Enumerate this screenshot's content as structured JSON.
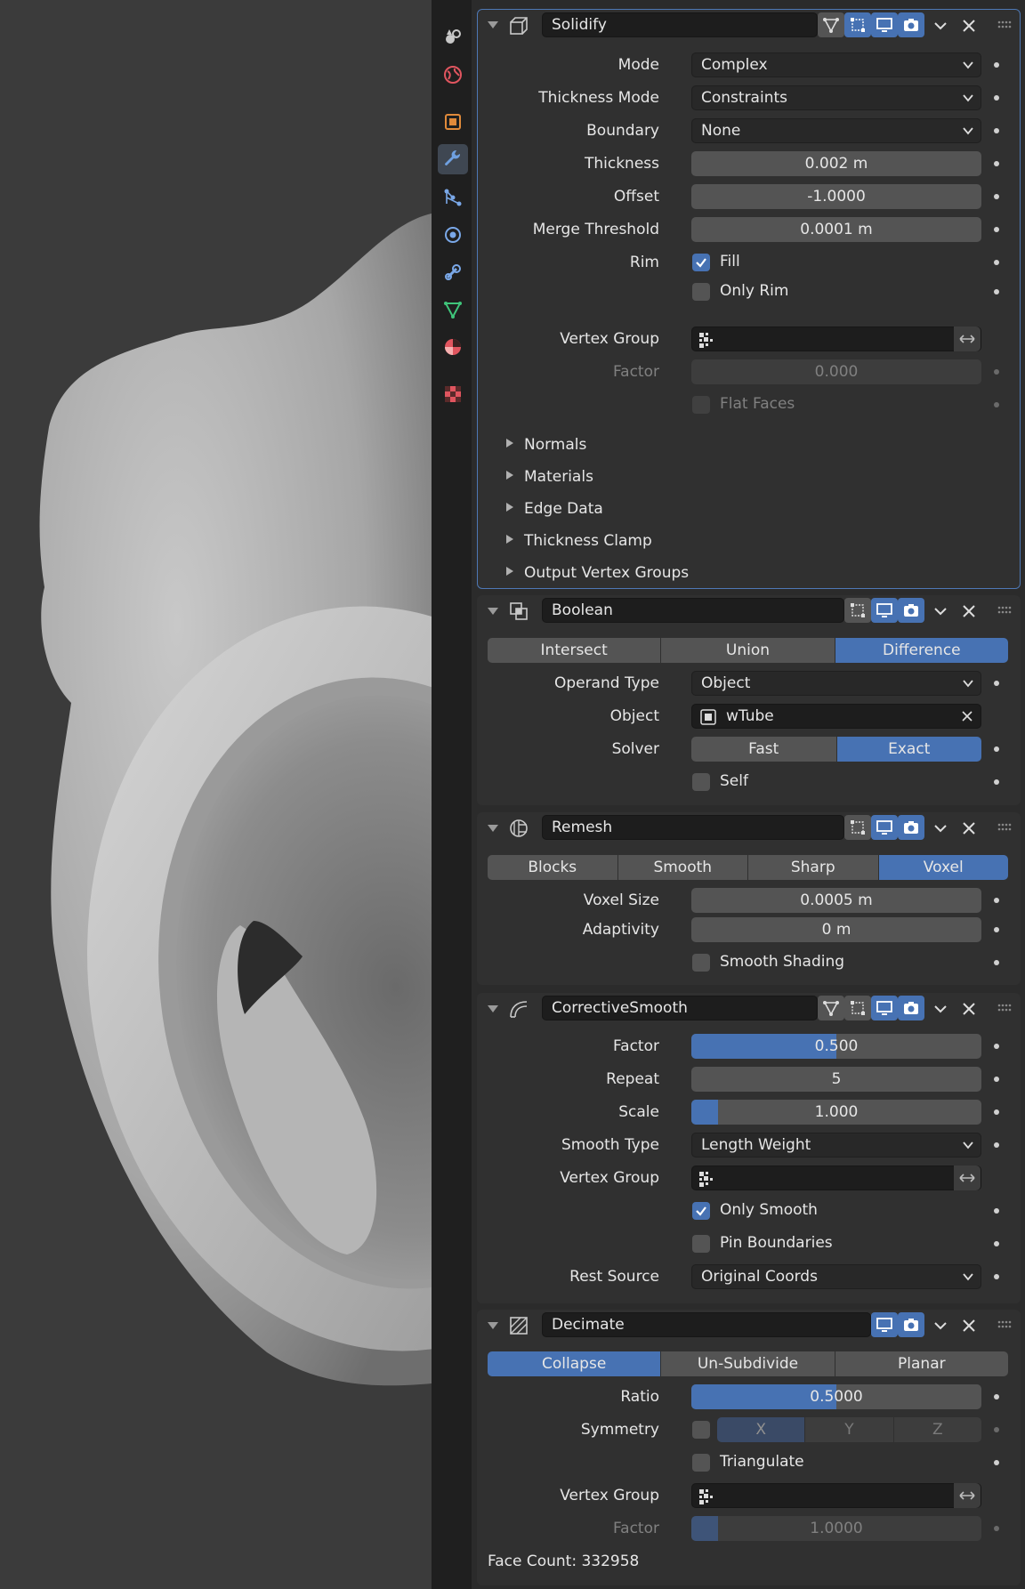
{
  "tabs": [
    "scene-icon",
    "world-icon",
    "object-icon",
    "modifier-wrench-icon",
    "particles-icon",
    "physics-icon",
    "constraints-icon",
    "object-data-mesh-icon",
    "material-icon",
    "texture-icon"
  ],
  "modifiers": {
    "solidify": {
      "name": "Solidify",
      "mode_label": "Mode",
      "mode_value": "Complex",
      "thickness_mode_label": "Thickness Mode",
      "thickness_mode_value": "Constraints",
      "boundary_label": "Boundary",
      "boundary_value": "None",
      "thickness_label": "Thickness",
      "thickness_value": "0.002 m",
      "offset_label": "Offset",
      "offset_value": "-1.0000",
      "merge_label": "Merge Threshold",
      "merge_value": "0.0001 m",
      "rim_label": "Rim",
      "fill_label": "Fill",
      "fill_checked": true,
      "only_rim_label": "Only Rim",
      "only_rim_checked": false,
      "vertex_group_label": "Vertex Group",
      "factor_label": "Factor",
      "factor_value": "0.000",
      "flat_faces_label": "Flat Faces",
      "subpanels": [
        "Normals",
        "Materials",
        "Edge Data",
        "Thickness Clamp",
        "Output Vertex Groups"
      ]
    },
    "boolean": {
      "name": "Boolean",
      "operations": [
        "Intersect",
        "Union",
        "Difference"
      ],
      "operation_selected": "Difference",
      "operand_type_label": "Operand Type",
      "operand_type_value": "Object",
      "object_label": "Object",
      "object_value": "wTube",
      "solver_label": "Solver",
      "solvers": [
        "Fast",
        "Exact"
      ],
      "solver_selected": "Exact",
      "self_label": "Self",
      "self_checked": false
    },
    "remesh": {
      "name": "Remesh",
      "modes": [
        "Blocks",
        "Smooth",
        "Sharp",
        "Voxel"
      ],
      "mode_selected": "Voxel",
      "voxel_size_label": "Voxel Size",
      "voxel_size_value": "0.0005 m",
      "adaptivity_label": "Adaptivity",
      "adaptivity_value": "0 m",
      "smooth_shading_label": "Smooth Shading",
      "smooth_shading_checked": false
    },
    "corrective_smooth": {
      "name": "CorrectiveSmooth",
      "factor_label": "Factor",
      "factor_value": "0.500",
      "factor_fraction": 0.5,
      "repeat_label": "Repeat",
      "repeat_value": "5",
      "scale_label": "Scale",
      "scale_value": "1.000",
      "smooth_type_label": "Smooth Type",
      "smooth_type_value": "Length Weight",
      "vertex_group_label": "Vertex Group",
      "only_smooth_label": "Only Smooth",
      "only_smooth_checked": true,
      "pin_boundaries_label": "Pin Boundaries",
      "pin_boundaries_checked": false,
      "rest_source_label": "Rest Source",
      "rest_source_value": "Original Coords"
    },
    "decimate": {
      "name": "Decimate",
      "modes": [
        "Collapse",
        "Un-Subdivide",
        "Planar"
      ],
      "mode_selected": "Collapse",
      "ratio_label": "Ratio",
      "ratio_value": "0.5000",
      "ratio_fraction": 0.5,
      "symmetry_label": "Symmetry",
      "symmetry_axes": [
        "X",
        "Y",
        "Z"
      ],
      "triangulate_label": "Triangulate",
      "vertex_group_label": "Vertex Group",
      "factor_label": "Factor",
      "factor_value": "1.0000",
      "face_count": "Face Count: 332958"
    }
  },
  "colors": {
    "accent": "#4772b3",
    "panel": "#303030",
    "field": "#545454"
  }
}
